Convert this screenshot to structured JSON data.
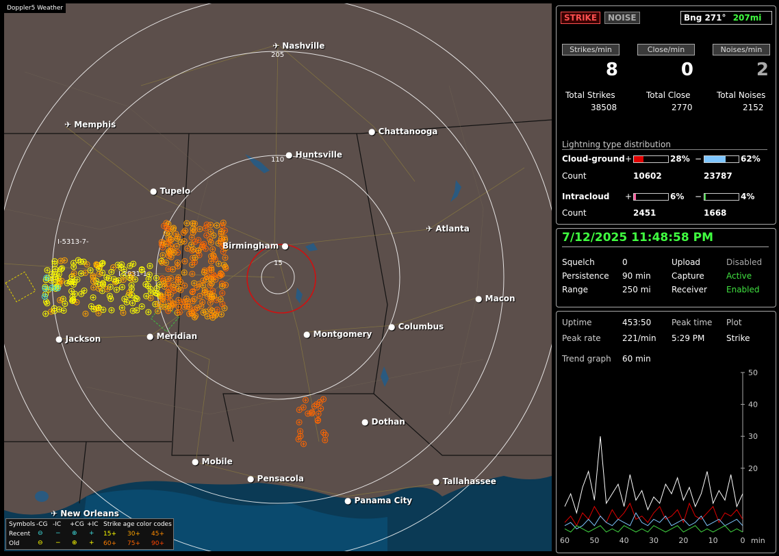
{
  "app": {
    "title": "Doppler5 Weather"
  },
  "map": {
    "ring_labels": [
      "205",
      "110",
      "15"
    ],
    "interstate_labels": [
      "I-5313-7-",
      "I-2931-1-"
    ],
    "cities": [
      "Nashville",
      "Memphis",
      "Chattanooga",
      "Huntsville",
      "Tupelo",
      "Birmingham",
      "Atlanta",
      "Macon",
      "Jackson",
      "Meridian",
      "Montgomery",
      "Columbus",
      "Dothan",
      "Mobile",
      "Pensacola",
      "Tallahassee",
      "Panama City",
      "New Orleans"
    ]
  },
  "legend": {
    "symbols_label": "Symbols",
    "cols": [
      "-CG",
      "-IC",
      "+CG",
      "+IC"
    ],
    "age_label": "Strike age color codes",
    "recent_label": "Recent",
    "old_label": "Old",
    "recent_ages": [
      "15+",
      "30+",
      "45+"
    ],
    "old_ages": [
      "60+",
      "75+",
      "90+"
    ],
    "age_colors": [
      "#ffff00",
      "#ffa500",
      "#ff8c00",
      "#ff7f00",
      "#ff6600",
      "#ff4500"
    ]
  },
  "status": {
    "strike_tag": "STRIKE",
    "noise_tag": "NOISE",
    "bearing": "Bng 271°",
    "distance": "207mi",
    "headers": [
      "Strikes/min",
      "Close/min",
      "Noises/min"
    ],
    "rates": [
      "8",
      "0",
      "2"
    ],
    "total_labels": [
      "Total Strikes",
      "Total Close",
      "Total Noises"
    ],
    "totals": [
      "38508",
      "2770",
      "2152"
    ],
    "dist_title": "Lightning type distribution",
    "cg_label": "Cloud-ground",
    "ic_label": "Intracloud",
    "count_label": "Count",
    "plus": "+",
    "minus": "−",
    "cg_pos_pct": "28%",
    "cg_neg_pct": "62%",
    "cg_pos_count": "10602",
    "cg_neg_count": "23787",
    "ic_pos_pct": "6%",
    "ic_neg_pct": "4%",
    "ic_pos_count": "2451",
    "ic_neg_count": "1668",
    "bar_fractions": {
      "cg_pos": 0.28,
      "cg_neg": 0.62,
      "ic_pos": 0.06,
      "ic_neg": 0.04
    },
    "bar_colors": {
      "cg_pos": "#e00000",
      "cg_neg": "#7fc6ff",
      "ic_pos": "#ff60a0",
      "ic_neg": "#40d040"
    }
  },
  "settings": {
    "datetime": "7/12/2025 11:48:58 PM",
    "squelch_label": "Squelch",
    "squelch": "0",
    "persistence_label": "Persistence",
    "persistence": "90 min",
    "range_label": "Range",
    "range": "250 mi",
    "upload_label": "Upload",
    "upload": "Disabled",
    "capture_label": "Capture",
    "capture": "Active",
    "receiver_label": "Receiver",
    "receiver": "Enabled"
  },
  "stats": {
    "uptime_label": "Uptime",
    "uptime": "453:50",
    "peak_time_label": "Peak time",
    "peak_time": "5:29 PM",
    "plot_label": "Plot",
    "plot": "Strike",
    "peak_rate_label": "Peak rate",
    "peak_rate": "221/min",
    "trend_label": "Trend graph",
    "trend": "60 min"
  },
  "chart_data": {
    "type": "line",
    "x": [
      60,
      58,
      56,
      54,
      52,
      50,
      48,
      46,
      44,
      42,
      40,
      38,
      36,
      34,
      32,
      30,
      28,
      26,
      24,
      22,
      20,
      18,
      16,
      14,
      12,
      10,
      8,
      6,
      4,
      2,
      0
    ],
    "xticks": [
      "60",
      "50",
      "40",
      "30",
      "20",
      "10",
      "0"
    ],
    "xunit": "min",
    "yticks": [
      "50",
      "40",
      "30",
      "20"
    ],
    "ylim": [
      0,
      50
    ],
    "series": [
      {
        "color": "#ffffff",
        "values": [
          8,
          12,
          6,
          14,
          19,
          10,
          30,
          9,
          12,
          15,
          8,
          18,
          10,
          13,
          7,
          11,
          9,
          15,
          12,
          17,
          10,
          14,
          8,
          12,
          19,
          9,
          13,
          10,
          18,
          8,
          12
        ]
      },
      {
        "color": "#e00000",
        "values": [
          3,
          5,
          2,
          6,
          4,
          8,
          5,
          3,
          7,
          4,
          6,
          9,
          4,
          5,
          3,
          6,
          8,
          4,
          5,
          7,
          3,
          9,
          5,
          4,
          6,
          8,
          3,
          6,
          5,
          7,
          4
        ]
      },
      {
        "color": "#7fc6ff",
        "values": [
          2,
          3,
          1,
          2,
          4,
          2,
          5,
          3,
          2,
          4,
          3,
          2,
          6,
          3,
          2,
          4,
          3,
          5,
          2,
          3,
          4,
          2,
          3,
          5,
          2,
          3,
          4,
          2,
          3,
          4,
          2
        ]
      },
      {
        "color": "#40d040",
        "values": [
          1,
          0,
          2,
          1,
          0,
          1,
          2,
          0,
          1,
          0,
          2,
          1,
          0,
          1,
          0,
          2,
          1,
          0,
          1,
          2,
          0,
          1,
          2,
          0,
          1,
          0,
          1,
          2,
          0,
          1,
          0
        ]
      }
    ]
  }
}
